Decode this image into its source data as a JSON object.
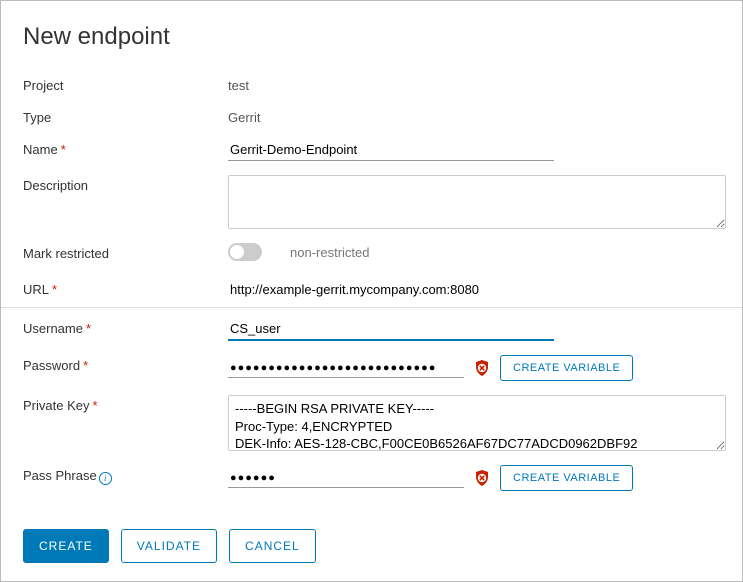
{
  "title": "New endpoint",
  "labels": {
    "project": "Project",
    "type": "Type",
    "name": "Name",
    "description": "Description",
    "mark_restricted": "Mark restricted",
    "url": "URL",
    "username": "Username",
    "password": "Password",
    "private_key": "Private Key",
    "pass_phrase": "Pass Phrase"
  },
  "values": {
    "project": "test",
    "type": "Gerrit",
    "name": "Gerrit-Demo-Endpoint",
    "description": "",
    "restricted_label": "non-restricted",
    "url": "http://example-gerrit.mycompany.com:8080",
    "username": "CS_user",
    "password": "●●●●●●●●●●●●●●●●●●●●●●●●●●●",
    "private_key": "-----BEGIN RSA PRIVATE KEY-----\nProc-Type: 4,ENCRYPTED\nDEK-Info: AES-128-CBC,F00CE0B6526AF67DC77ADCD0962DBF92",
    "pass_phrase": "●●●●●●"
  },
  "buttons": {
    "create_variable": "CREATE VARIABLE",
    "create": "CREATE",
    "validate": "VALIDATE",
    "cancel": "CANCEL"
  }
}
